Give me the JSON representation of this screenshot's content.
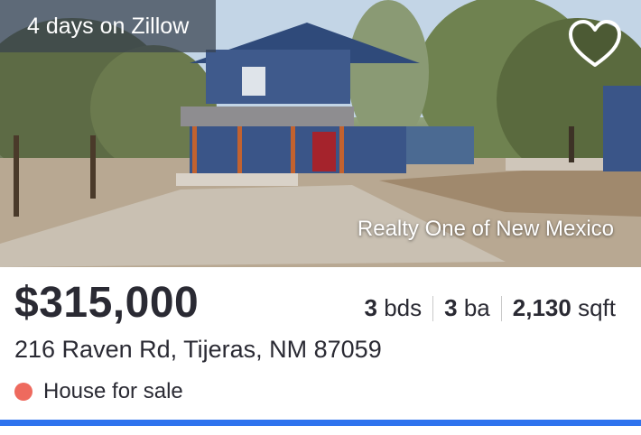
{
  "listing": {
    "days_on": "4 days on Zillow",
    "watermark": "Realty One of New Mexico",
    "price": "$315,000",
    "beds_value": "3",
    "beds_unit": "bds",
    "baths_value": "3",
    "baths_unit": "ba",
    "sqft_value": "2,130",
    "sqft_unit": "sqft",
    "address": "216 Raven Rd, Tijeras, NM 87059",
    "status": "House for sale"
  },
  "colors": {
    "accent_bar": "#2f73ee",
    "status_dot": "#ee6a5e",
    "house_siding": "#3f5a8c"
  },
  "icons": {
    "favorite": "heart-icon"
  }
}
